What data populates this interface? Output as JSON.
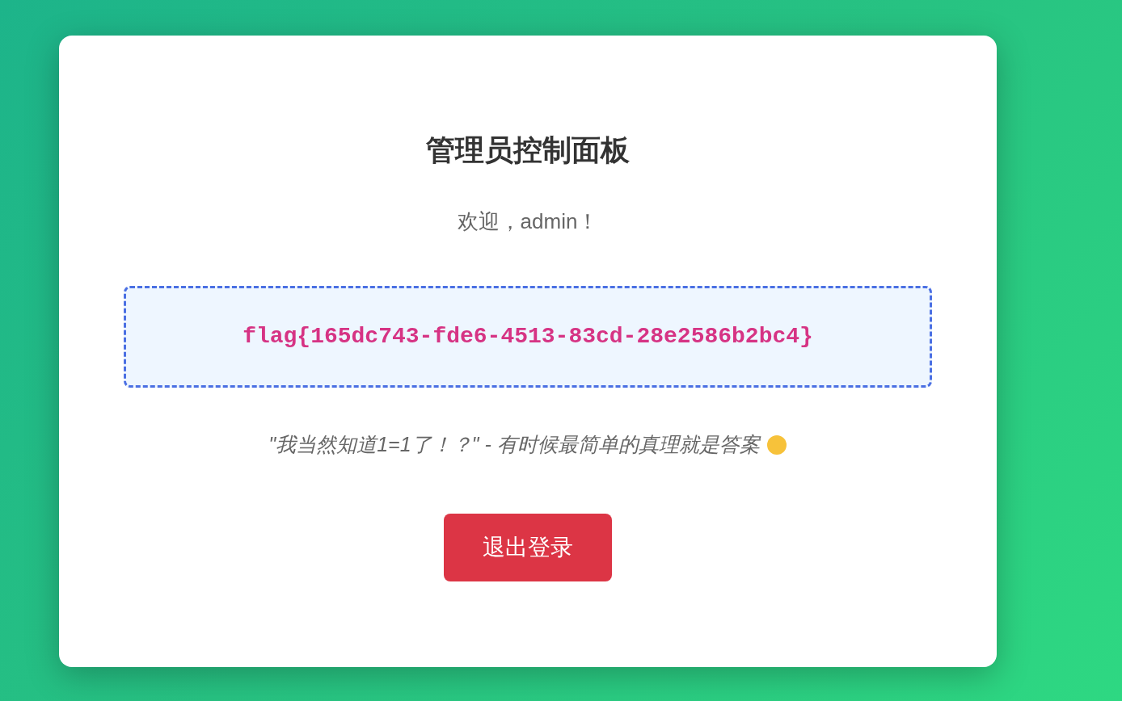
{
  "panel": {
    "title": "管理员控制面板",
    "welcome": "欢迎，admin！",
    "flag": "flag{165dc743-fde6-4513-83cd-28e2586b2bc4}",
    "quote": "\"我当然知道1=1了！？\" - 有时候最简单的真理就是答案",
    "logout_button": "退出登录"
  }
}
